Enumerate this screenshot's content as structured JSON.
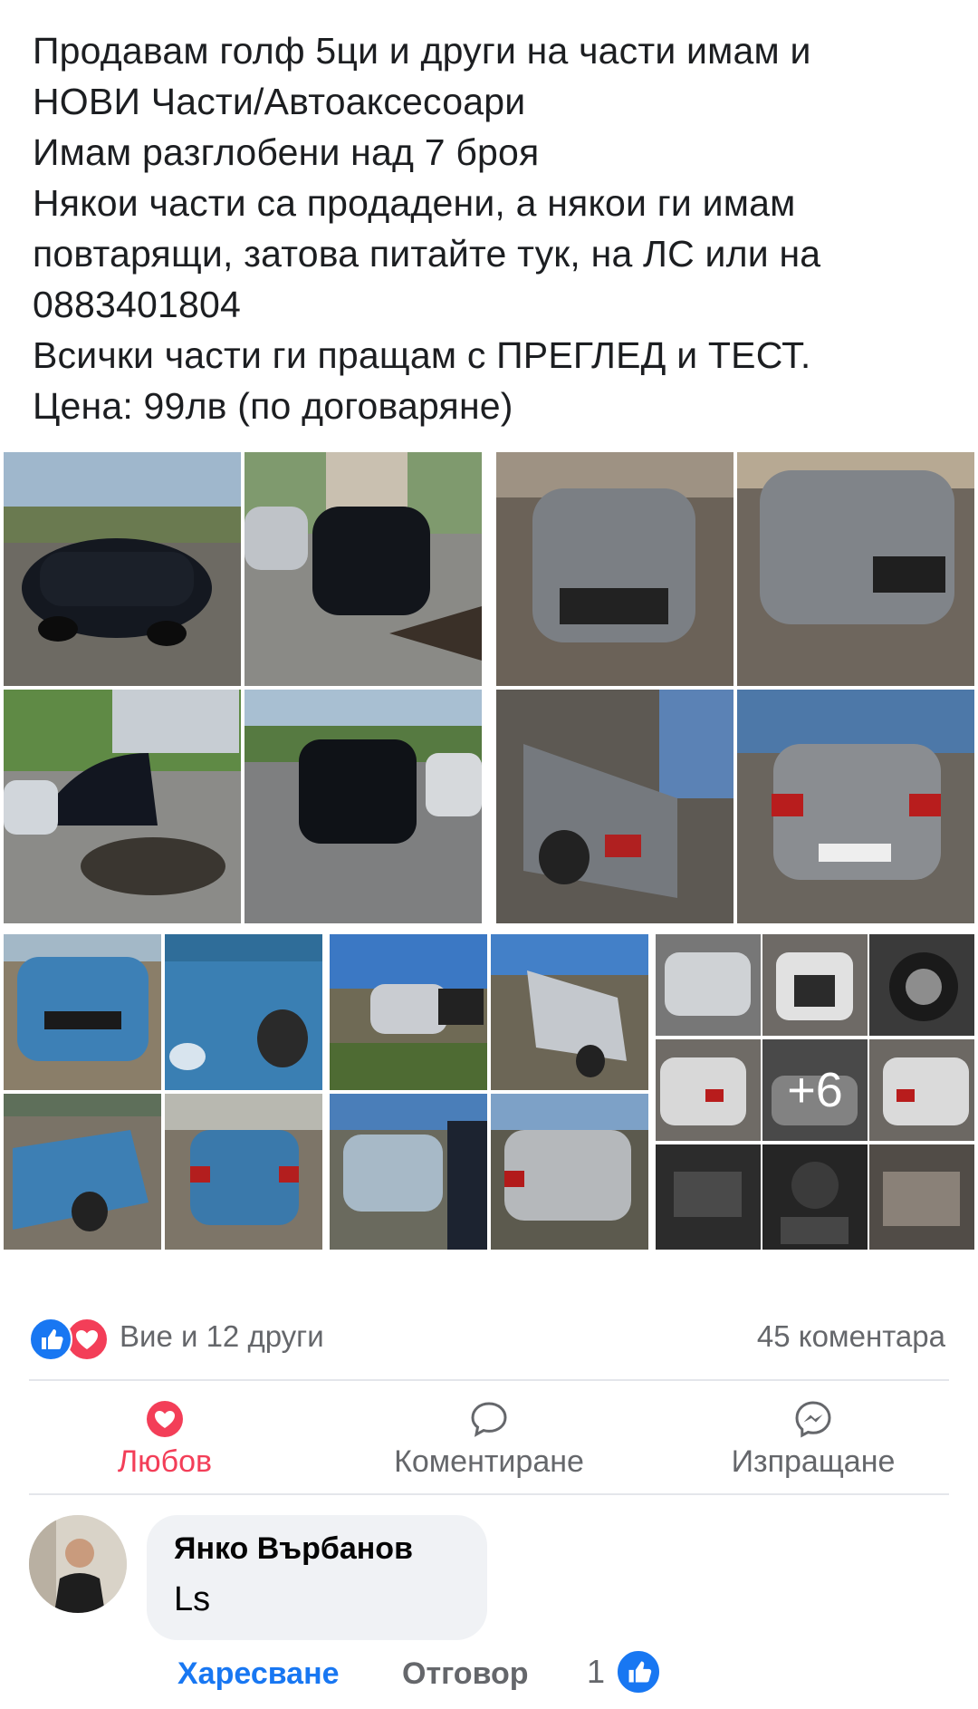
{
  "post": {
    "lines": [
      "Продавам голф 5ци и други на части имам и",
      "НОВИ Части/Автоаксесоари",
      "Имам разглобени над 7 броя",
      "Някои части са продадени, а някои ги имам",
      "повтарящи, затова питайте тук, на ЛС или на",
      "0883401804",
      "Всички части ги пращам с ПРЕГЛЕД и ТЕСТ.",
      "Цена: 99лв (по договаряне)"
    ]
  },
  "gallery": {
    "more_label": "+6"
  },
  "reactions": {
    "summary": "Вие и 12 други",
    "comments": "45 коментара"
  },
  "actions": {
    "love": "Любов",
    "comment": "Коментиране",
    "share": "Изпращане"
  },
  "comment": {
    "author": "Янко Върбанов",
    "text": "Ls",
    "like": "Харесване",
    "reply": "Отговор",
    "likes_count": "1"
  },
  "colors": {
    "like_blue": "#1877f2",
    "love_red": "#f33e58",
    "muted_text": "#65676b"
  }
}
